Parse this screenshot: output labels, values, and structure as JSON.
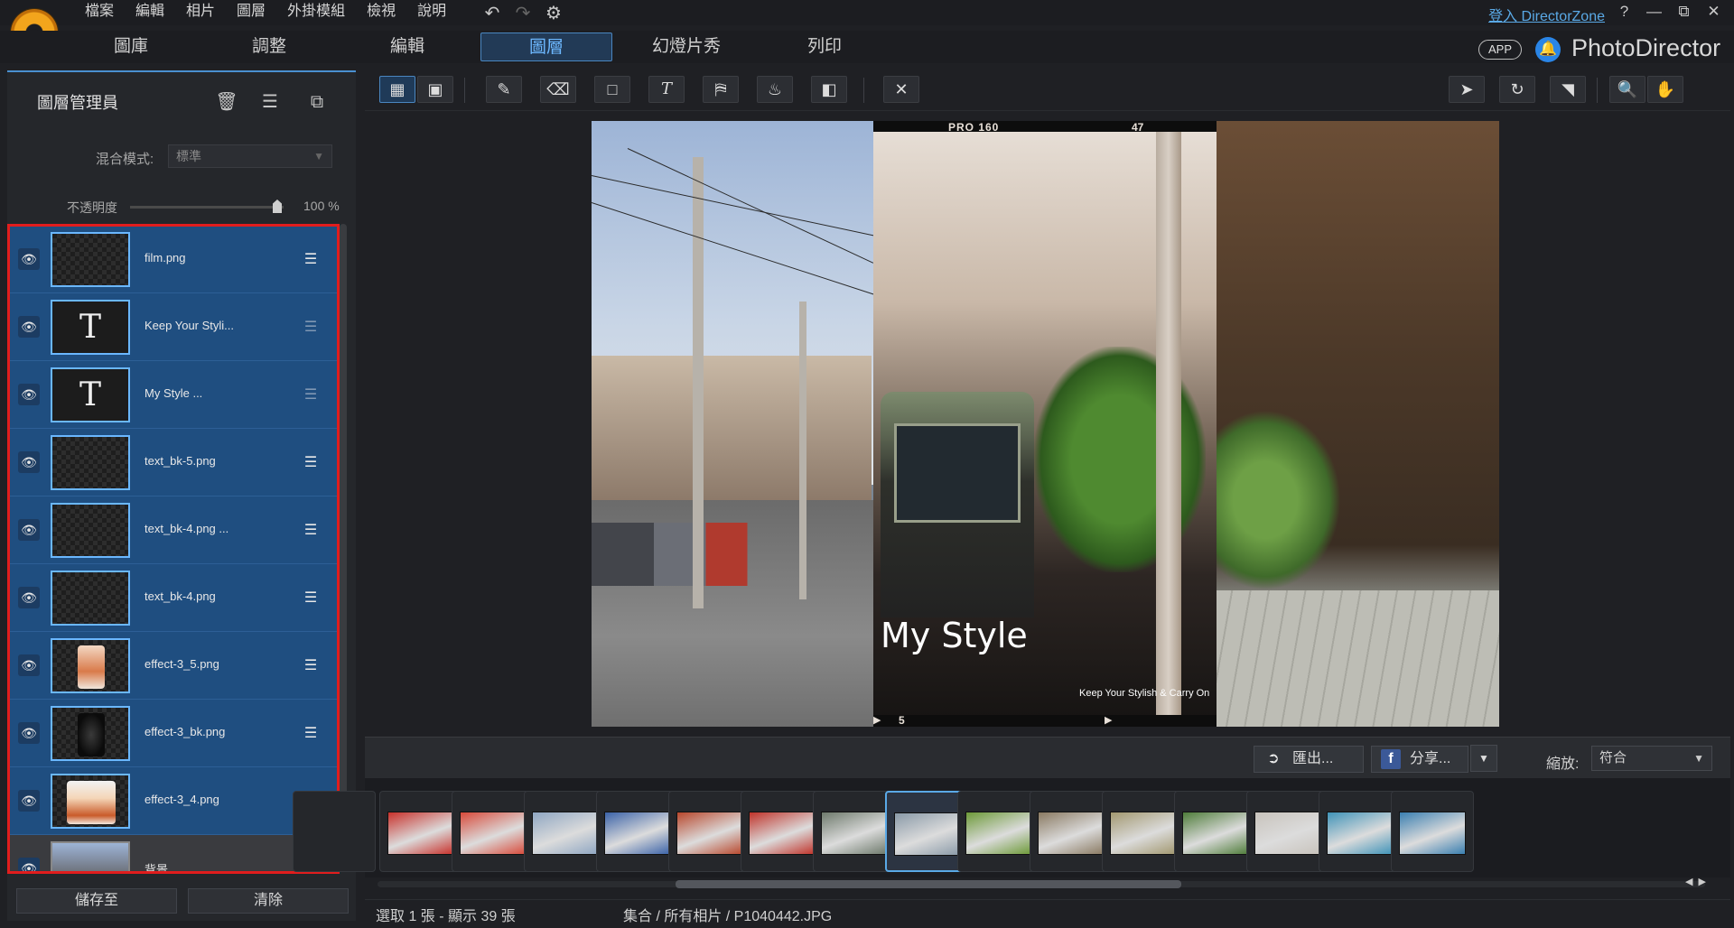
{
  "menu": [
    "檔案",
    "編輯",
    "相片",
    "圖層",
    "外掛模組",
    "檢視",
    "說明"
  ],
  "toolbar_top": {
    "undo_icon": "undo-icon",
    "redo_icon": "redo-icon",
    "settings_icon": "gear-icon"
  },
  "account": {
    "login_text": "登入 DirectorZone",
    "help": "?"
  },
  "modes": [
    "圖庫",
    "調整",
    "編輯",
    "圖層",
    "幻燈片秀",
    "列印"
  ],
  "active_mode": "圖層",
  "brand": {
    "app_pill": "APP",
    "name": "PhotoDirector",
    "accent": "#f3a51c"
  },
  "layer_panel": {
    "title": "圖層管理員",
    "blend_label": "混合模式:",
    "blend_value": "標準",
    "opacity_label": "不透明度",
    "opacity_value": "100 %",
    "opacity": 1.0,
    "layers": [
      {
        "name": "film.png",
        "type": "image"
      },
      {
        "name": "Keep Your Styli...",
        "type": "text",
        "glyph": "T"
      },
      {
        "name": "My Style        ...",
        "type": "text",
        "glyph": "T"
      },
      {
        "name": "text_bk-5.png",
        "type": "image"
      },
      {
        "name": "text_bk-4.png ...",
        "type": "image"
      },
      {
        "name": "text_bk-4.png",
        "type": "image"
      },
      {
        "name": "effect-3_5.png",
        "type": "image"
      },
      {
        "name": "effect-3_bk.png",
        "type": "image"
      },
      {
        "name": "effect-3_4.png",
        "type": "image"
      },
      {
        "name": "背景",
        "type": "background"
      }
    ],
    "save_button": "儲存至",
    "clear_button": "清除"
  },
  "canvas": {
    "film_code": "PRO 160",
    "film_number": "47",
    "film_frame": "5",
    "title_text": "My Style",
    "subtitle_text": "Keep Your Stylish & Carry On"
  },
  "strip_toolbar": {
    "export_label": "匯出...",
    "share_label": "分享...",
    "zoom_label": "縮放:",
    "zoom_value": "符合"
  },
  "filmstrip": {
    "selected_index": 7,
    "thumb_colors": [
      "#c8312b",
      "#d84a3a",
      "#8fa6c2",
      "#3b63a8",
      "#b8472c",
      "#c0332a",
      "#6e7a6c",
      "#8a9aa8",
      "#6d9a38",
      "#8a7a62",
      "#a29870",
      "#4f7d3a",
      "#c8c3bc",
      "#3f93b8",
      "#3a7fb0"
    ]
  },
  "status": {
    "count": "選取 1 張 - 顯示 39 張",
    "path": "集合 / 所有相片 / P1040442.JPG"
  }
}
